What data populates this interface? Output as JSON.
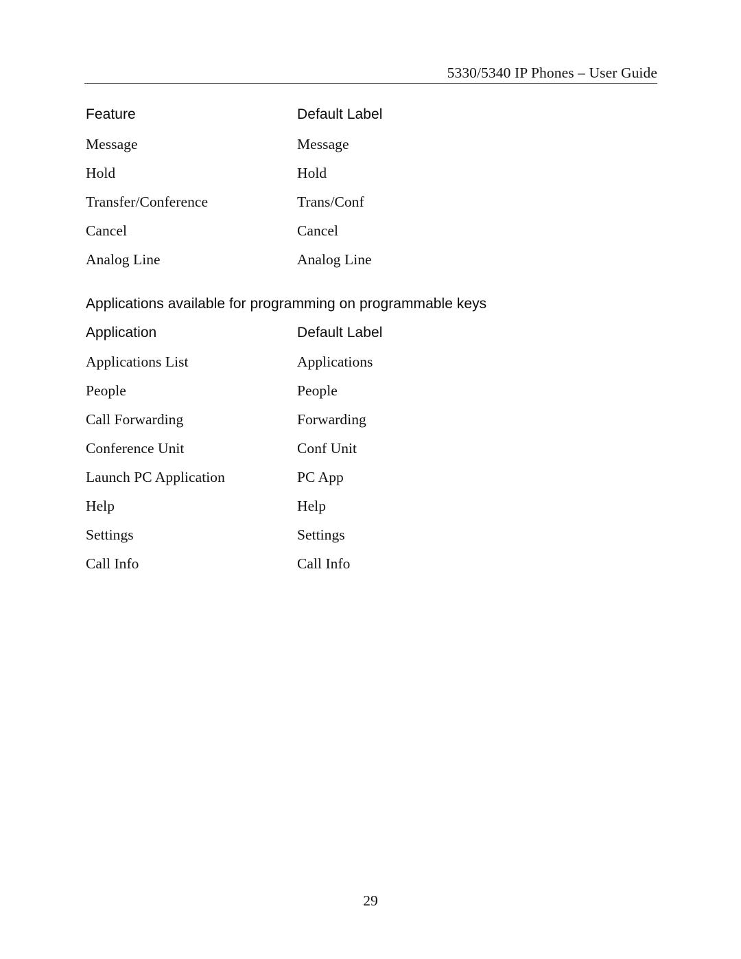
{
  "header": {
    "running_title": "5330/5340 IP Phones – User Guide"
  },
  "feature_table": {
    "columns": [
      "Feature",
      "Default Label"
    ],
    "rows": [
      {
        "feature": "Message",
        "default_label": "Message"
      },
      {
        "feature": "Hold",
        "default_label": "Hold"
      },
      {
        "feature": "Transfer/Conference",
        "default_label": "Trans/Conf"
      },
      {
        "feature": "Cancel",
        "default_label": "Cancel"
      },
      {
        "feature": "Analog Line",
        "default_label": "Analog Line"
      }
    ]
  },
  "applications_section": {
    "heading": "Applications available for programming on programmable keys",
    "columns": [
      "Application",
      "Default Label"
    ],
    "rows": [
      {
        "application": "Applications List",
        "default_label": "Applications"
      },
      {
        "application": "People",
        "default_label": "People"
      },
      {
        "application": "Call Forwarding",
        "default_label": "Forwarding"
      },
      {
        "application": "Conference Unit",
        "default_label": "Conf Unit"
      },
      {
        "application": "Launch PC Application",
        "default_label": "PC App"
      },
      {
        "application": "Help",
        "default_label": "Help"
      },
      {
        "application": "Settings",
        "default_label": "Settings"
      },
      {
        "application": "Call Info",
        "default_label": "Call Info"
      }
    ]
  },
  "footer": {
    "page_number": "29"
  }
}
